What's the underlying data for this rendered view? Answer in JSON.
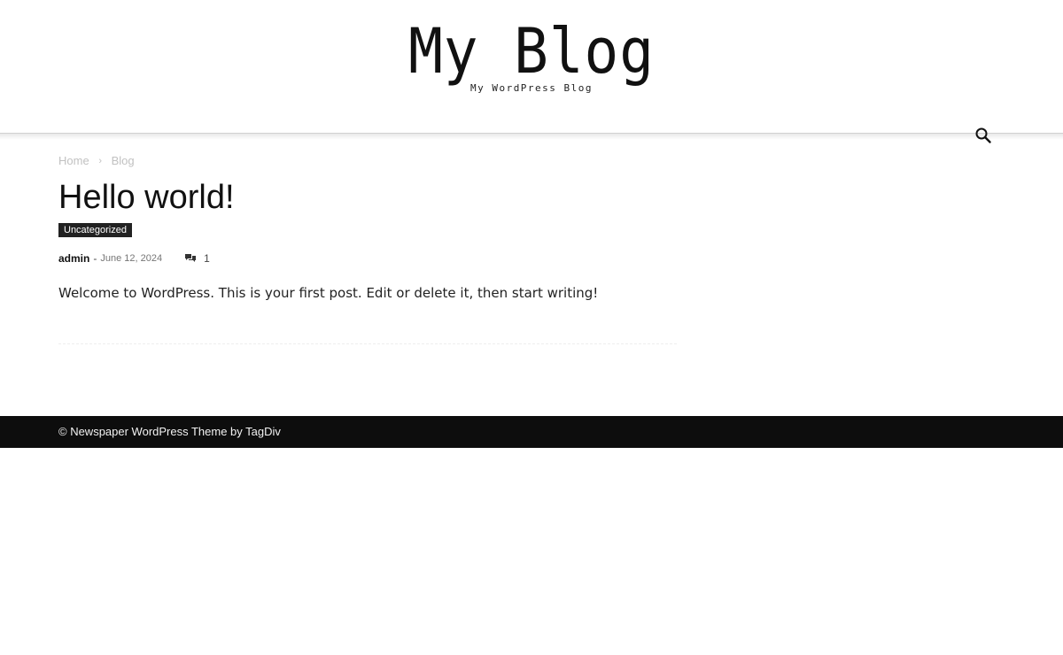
{
  "header": {
    "site_title": "My Blog",
    "tagline": "My WordPress Blog",
    "search_icon": "search-icon"
  },
  "breadcrumb": {
    "items": [
      "Home",
      "Blog"
    ],
    "separator": "›"
  },
  "post": {
    "title": "Hello world!",
    "category": "Uncategorized",
    "author": "admin",
    "dash": "-",
    "date": "June 12, 2024",
    "comments_icon": "comments-icon",
    "comment_count": "1",
    "content": "Welcome to WordPress. This is your first post. Edit or delete it, then start writing!"
  },
  "footer": {
    "copyright": "© Newspaper WordPress Theme by TagDiv"
  },
  "colors": {
    "footer_bg": "#0d0d0d",
    "badge_bg": "#222222",
    "breadcrumb_text": "#c1c1c1"
  }
}
